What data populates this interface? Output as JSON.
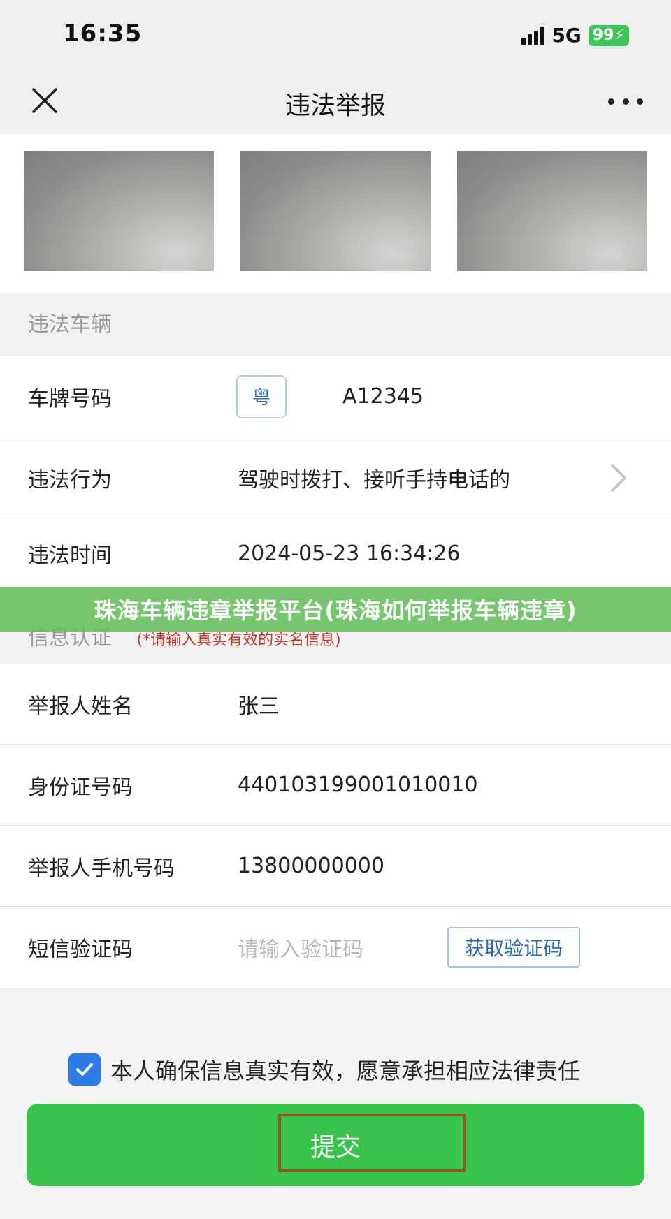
{
  "status": {
    "time": "16:35",
    "network": "5G",
    "battery": "99"
  },
  "nav": {
    "title": "违法举报"
  },
  "sections": {
    "vehicle": "违法车辆",
    "identity": "信息认证",
    "identity_note": "(*请输入真实有效的实名信息)"
  },
  "vehicle": {
    "plate_label": "车牌号码",
    "plate_prefix": "粤",
    "plate_number": "A12345",
    "behavior_label": "违法行为",
    "behavior_value": "驾驶时拨打、接听手持电话的",
    "time_label": "违法时间",
    "time_value": "2024-05-23 16:34:26"
  },
  "identity": {
    "name_label": "举报人姓名",
    "name_value": "张三",
    "id_label": "身份证号码",
    "id_value": "440103199001010010",
    "phone_label": "举报人手机号码",
    "phone_value": "13800000000",
    "sms_label": "短信验证码",
    "sms_placeholder": "请输入验证码",
    "sms_button": "获取验证码"
  },
  "overlay": {
    "text": "珠海车辆违章举报平台(珠海如何举报车辆违章)"
  },
  "agreement": {
    "text": "本人确保信息真实有效，愿意承担相应法律责任",
    "checked": true
  },
  "submit": {
    "label": "提交"
  },
  "colors": {
    "primary_green": "#39c24c",
    "checkbox_blue": "#2d7be5",
    "link_blue": "#2f6aa8"
  }
}
